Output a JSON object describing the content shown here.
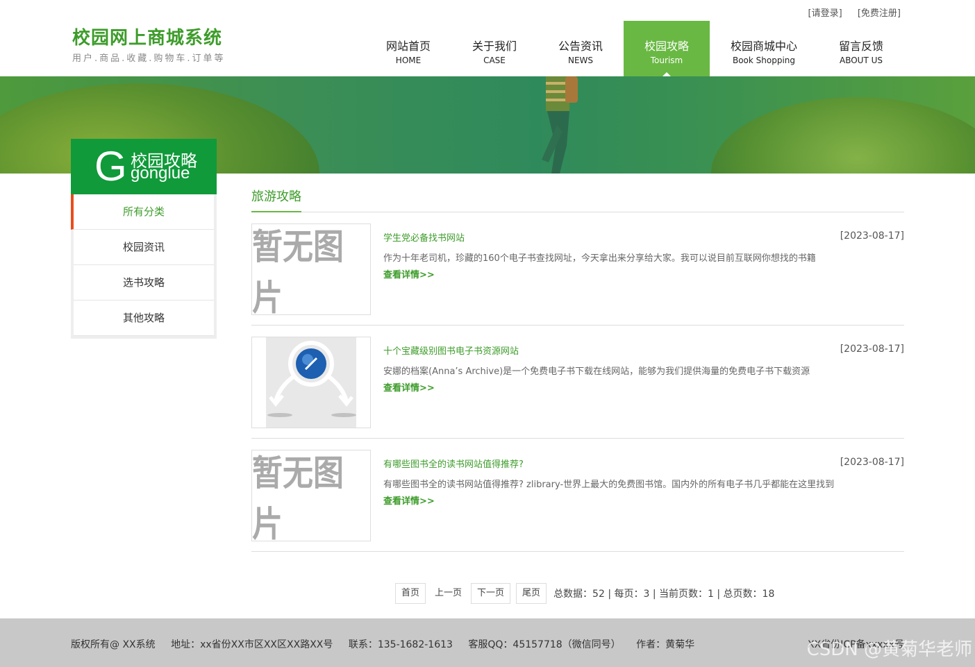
{
  "top_links": {
    "login": "[请登录]",
    "register": "[免费注册]"
  },
  "logo": {
    "title": "校园网上商城系统",
    "subtitle": "用户.商品.收藏.购物车.订单等"
  },
  "nav": [
    {
      "cn": "网站首页",
      "en": "HOME"
    },
    {
      "cn": "关于我们",
      "en": "CASE"
    },
    {
      "cn": "公告资讯",
      "en": "NEWS"
    },
    {
      "cn": "校园攻略",
      "en": "Tourism",
      "active": true
    },
    {
      "cn": "校园商城中心",
      "en": "Book Shopping"
    },
    {
      "cn": "留言反馈",
      "en": "ABOUT US"
    }
  ],
  "sidebar": {
    "letter": "G",
    "title": "校园攻略",
    "pinyin": "gonglue",
    "items": [
      "所有分类",
      "校园资讯",
      "选书攻略",
      "其他攻略"
    ]
  },
  "section_title": "旅游攻略",
  "articles": [
    {
      "title": "学生党必备找书网站",
      "date": "[2023-08-17]",
      "desc": "作为十年老司机，珍藏的160个电子书查找网址，今天拿出来分享给大家。我可以说目前互联网你想找的书籍",
      "more": "查看详情>>",
      "image": "暂无图片"
    },
    {
      "title": "十个宝藏级别图书电子书资源网站",
      "date": "[2023-08-17]",
      "desc": "安娜的档案(Anna’s Archive)是一个免费电子书下载在线网站，能够为我们提供海量的免费电子书下载资源",
      "more": "查看详情>>",
      "image": "broken-image-icon"
    },
    {
      "title": "有哪些图书全的读书网站值得推荐?",
      "date": "[2023-08-17]",
      "desc": "有哪些图书全的读书网站值得推荐? zlibrary-世界上最大的免费图书馆。国内外的所有电子书几乎都能在这里找到",
      "more": "查看详情>>",
      "image": "暂无图片"
    }
  ],
  "pager": {
    "first": "首页",
    "prev": "上一页",
    "next": "下一页",
    "last": "尾页",
    "info": "总数据：52 | 每页：3 | 当前页数：1 | 总页数：18"
  },
  "footer": {
    "copyright": "版权所有@ XX系统",
    "address": "地址：xx省份XX市区XX区XX路XX号",
    "contact": "联系：135-1682-1613",
    "qq": "客服QQ：45157718（微信同号）",
    "author": "作者：黄菊华",
    "icp": "XX省份ICP备xxxxx号",
    "watermark": "CSDN @黄菊华老师"
  },
  "colors": {
    "brand_green": "#69b843",
    "sidebar_green": "#109a3a",
    "text_green": "#3d9c2a",
    "accent_red": "#e84d1c"
  }
}
